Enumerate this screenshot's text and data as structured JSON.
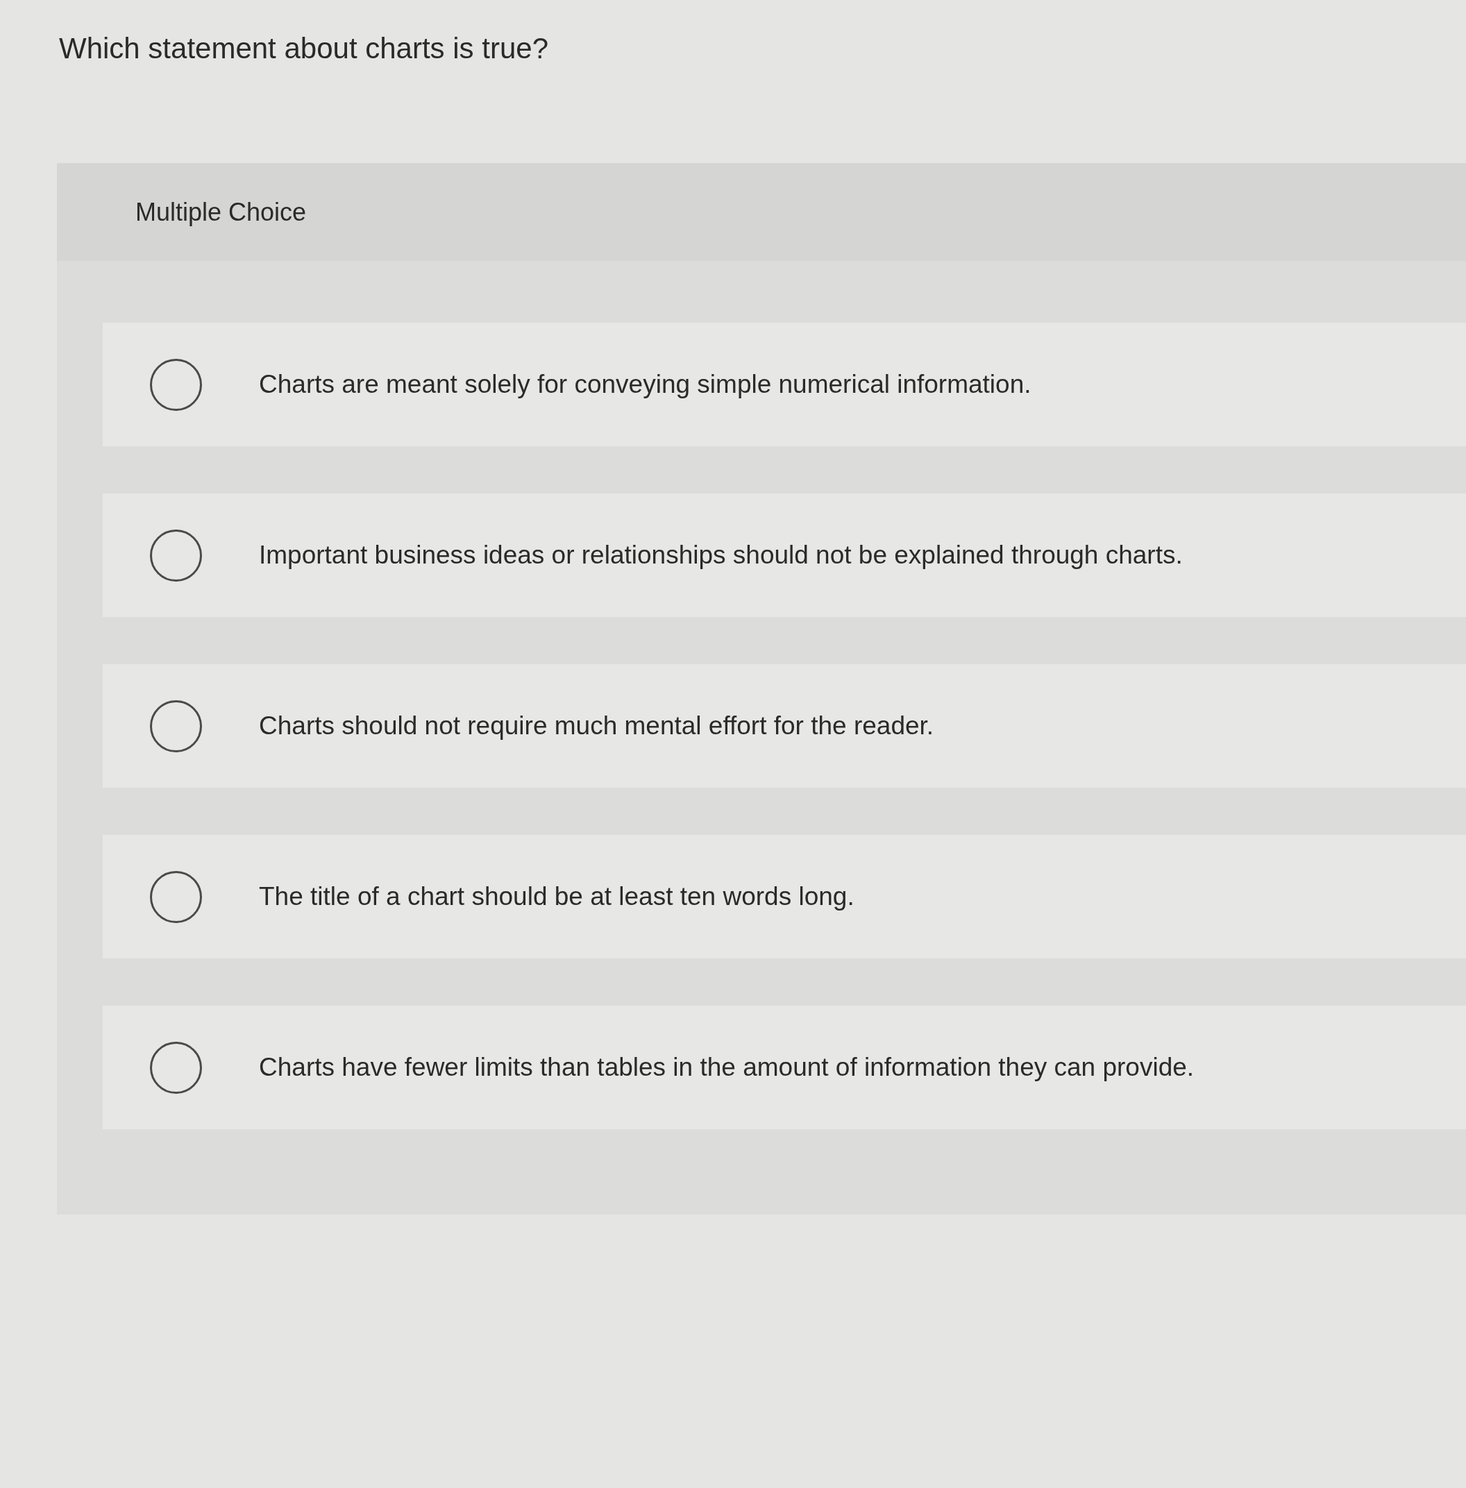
{
  "question": "Which statement about charts is true?",
  "answer_panel": {
    "type_label": "Multiple Choice",
    "options": [
      {
        "text": "Charts are meant solely for conveying simple numerical information.",
        "selected": false
      },
      {
        "text": "Important business ideas or relationships should not be explained through charts.",
        "selected": false
      },
      {
        "text": "Charts should not require much mental effort for the reader.",
        "selected": false
      },
      {
        "text": "The title of a chart should be at least ten words long.",
        "selected": false
      },
      {
        "text": "Charts have fewer limits than tables in the amount of information they can provide.",
        "selected": false
      }
    ]
  }
}
